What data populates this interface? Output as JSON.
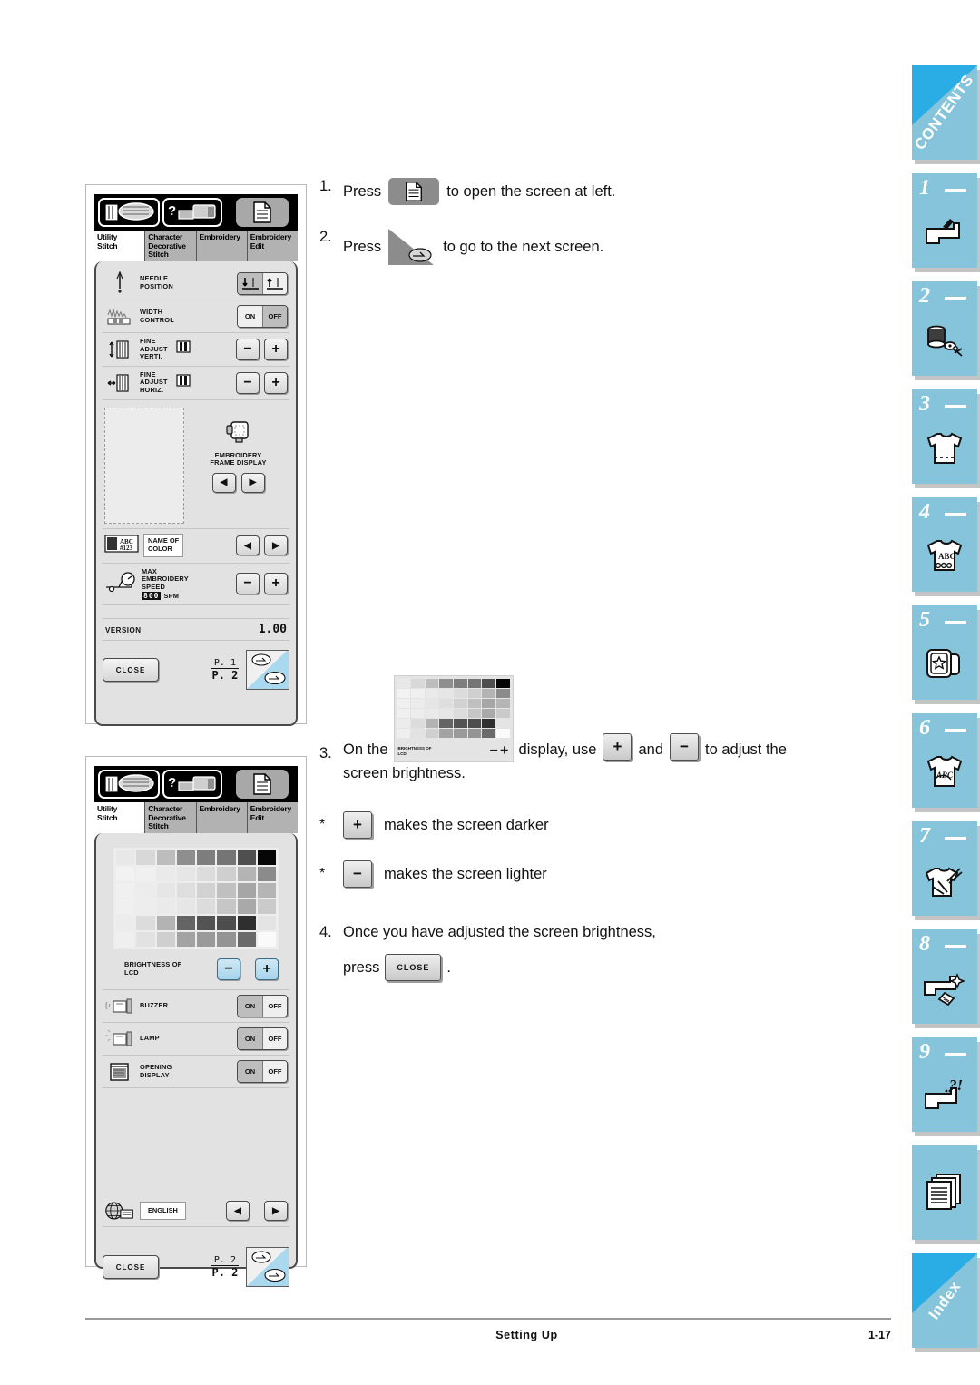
{
  "document": {
    "footer_section": "Setting Up",
    "footer_page": "1-17"
  },
  "tab_rail": {
    "tabs": [
      {
        "label": "CONTENTS",
        "type": "word",
        "icon": "contents-corner"
      },
      {
        "number": "1",
        "type": "num",
        "icon": "sewing-machine-needle-icon"
      },
      {
        "number": "2",
        "type": "num",
        "icon": "thread-spool-bobbin-icon"
      },
      {
        "number": "3",
        "type": "num",
        "icon": "tshirt-stitch-icon"
      },
      {
        "number": "4",
        "type": "num",
        "icon": "tshirt-abc-embroidery-icon"
      },
      {
        "number": "5",
        "type": "num",
        "icon": "embroidery-card-star-icon"
      },
      {
        "number": "6",
        "type": "num",
        "icon": "tshirt-monogram-icon"
      },
      {
        "number": "7",
        "type": "num",
        "icon": "tshirt-scissors-icon"
      },
      {
        "number": "8",
        "type": "num",
        "icon": "machine-sparkle-icon"
      },
      {
        "number": "9",
        "type": "num",
        "icon": "machine-question-icon"
      },
      {
        "type": "plain",
        "icon": "documents-stack-icon"
      },
      {
        "label": "Index",
        "type": "word",
        "icon": "index-corner"
      }
    ]
  },
  "panel_1": {
    "name": "settings-screen-page-1",
    "icon_buttons": [
      "stitch-selection-icon",
      "machine-help-icon",
      "settings-list-icon"
    ],
    "tabs": [
      {
        "label": "Utility\nStitch",
        "active": true
      },
      {
        "label": "Character\nDecorative\nStitch",
        "active": false
      },
      {
        "label": "Embroidery",
        "active": false
      },
      {
        "label": "Embroidery\nEdit",
        "active": false
      }
    ],
    "rows": [
      {
        "icon": "needle-icon",
        "label": "NEEDLE\nPOSITION",
        "control": "needle-position-toggle",
        "options": [
          "down",
          "up"
        ],
        "selected": "down"
      },
      {
        "icon": "width-control-icon",
        "label": "WIDTH\nCONTROL",
        "control": "on-off-toggle",
        "options": [
          "ON",
          "OFF"
        ],
        "selected": "OFF"
      },
      {
        "icon": "fine-adjust-vertical-icon",
        "label": "FINE\nADJUST\nVERTI.",
        "control": "minus-plus",
        "minus": "−",
        "plus": "+"
      },
      {
        "icon": "fine-adjust-horizontal-icon",
        "label": "FINE\nADJUST\nHORIZ.",
        "control": "minus-plus",
        "minus": "−",
        "plus": "+"
      }
    ],
    "embroidery_frame": {
      "label": "EMBROIDERY\nFRAME DISPLAY",
      "icon": "embroidery-hoop-icon",
      "left_arrow": "◀",
      "right_arrow": "▶"
    },
    "name_of_color": {
      "icon": "spool-abc-123-icon",
      "label": "NAME OF\nCOLOR",
      "left_arrow": "◀",
      "right_arrow": "▶"
    },
    "max_speed": {
      "icon": "speed-gauge-icon",
      "label": "MAX\nEMBROIDERY\nSPEED",
      "value": "800",
      "unit": "SPM",
      "minus": "−",
      "plus": "+"
    },
    "version": {
      "label": "VERSION",
      "value": "1.00"
    },
    "close_label": "CLOSE",
    "page_top": "P. 1",
    "page_bottom": "P. 2",
    "turn_page_icon": "pointing-hand-page-turn-icon"
  },
  "panel_2": {
    "name": "settings-screen-page-2",
    "icon_buttons": [
      "stitch-selection-icon",
      "machine-help-icon",
      "settings-list-icon"
    ],
    "tabs": [
      {
        "label": "Utility\nStitch",
        "active": true
      },
      {
        "label": "Character\nDecorative\nStitch",
        "active": false
      },
      {
        "label": "Embroidery",
        "active": false
      },
      {
        "label": "Embroidery\nEdit",
        "active": false
      }
    ],
    "brightness": {
      "label": "BRIGHTNESS OF\nLCD",
      "minus": "−",
      "plus": "+",
      "grid_rows": [
        [
          "#e8e8e8",
          "#d8d8d8",
          "#bdbdbd",
          "#8e8e8e",
          "#7e7e7e",
          "#757575",
          "#4f4f4f",
          "#050505"
        ],
        [
          "#f2f2f2",
          "#f0f0f0",
          "#eaeaea",
          "#e6e6e6",
          "#dcdcdc",
          "#cfcfcf",
          "#b4b4b4",
          "#8b8b8b"
        ],
        [
          "#f0f0f0",
          "#ececec",
          "#e6e6e6",
          "#dedede",
          "#d2d2d2",
          "#c0c0c0",
          "#a6a6a6",
          "#b5b5b5"
        ],
        [
          "#f0f0f0",
          "#ededed",
          "#eaeaea",
          "#e6e6e6",
          "#dcdcdc",
          "#c6c6c6",
          "#a9a9a9",
          "#cacaca"
        ],
        [
          "#ececec",
          "#dcdcdc",
          "#b3b3b3",
          "#646464",
          "#535353",
          "#4d4d4d",
          "#2f2f2f",
          "#e4e4e4"
        ],
        [
          "#efefef",
          "#e2e2e2",
          "#cfcfcf",
          "#a3a3a3",
          "#9a9a9a",
          "#949494",
          "#6a6a6a",
          "#fafafa"
        ]
      ]
    },
    "rows": [
      {
        "icon": "buzzer-icon",
        "label": "BUZZER",
        "options": [
          "ON",
          "OFF"
        ],
        "selected": "ON"
      },
      {
        "icon": "lamp-icon",
        "label": "LAMP",
        "options": [
          "ON",
          "OFF"
        ],
        "selected": "ON"
      },
      {
        "icon": "opening-display-icon",
        "label": "OPENING\nDISPLAY",
        "options": [
          "ON",
          "OFF"
        ],
        "selected": "ON"
      }
    ],
    "language": {
      "icon": "globe-language-icon",
      "value": "ENGLISH",
      "left_arrow": "◀",
      "right_arrow": "▶"
    },
    "close_label": "CLOSE",
    "page_top": "P. 2",
    "page_bottom": "P. 2",
    "turn_page_icon": "pointing-hand-page-turn-icon"
  },
  "instructions": {
    "step1": {
      "num": "1.",
      "before": "Press",
      "after": "to open the screen at left.",
      "icon": "settings-list-icon"
    },
    "step2": {
      "num": "2.",
      "before": "Press",
      "after": "to go to the next screen.",
      "icon": "page-turn-corner-icon"
    },
    "step3": {
      "num": "3.",
      "part1": "On  the",
      "part2": "display,  use",
      "and": "and",
      "part3": "to  adjust  the",
      "line2": "screen brightness.",
      "plus": "+",
      "minus": "−",
      "thumb_label": "BRIGHTNESS OF\nLCD"
    },
    "bullet1": {
      "mark": "*",
      "btn": "+",
      "text": "makes the screen darker"
    },
    "bullet2": {
      "mark": "*",
      "btn": "−",
      "text": "makes the screen lighter"
    },
    "step4": {
      "num": "4.",
      "line1": "Once you have adjusted the screen brightness,",
      "line2_before": "press",
      "line2_after": ".",
      "close_label": "CLOSE"
    }
  }
}
